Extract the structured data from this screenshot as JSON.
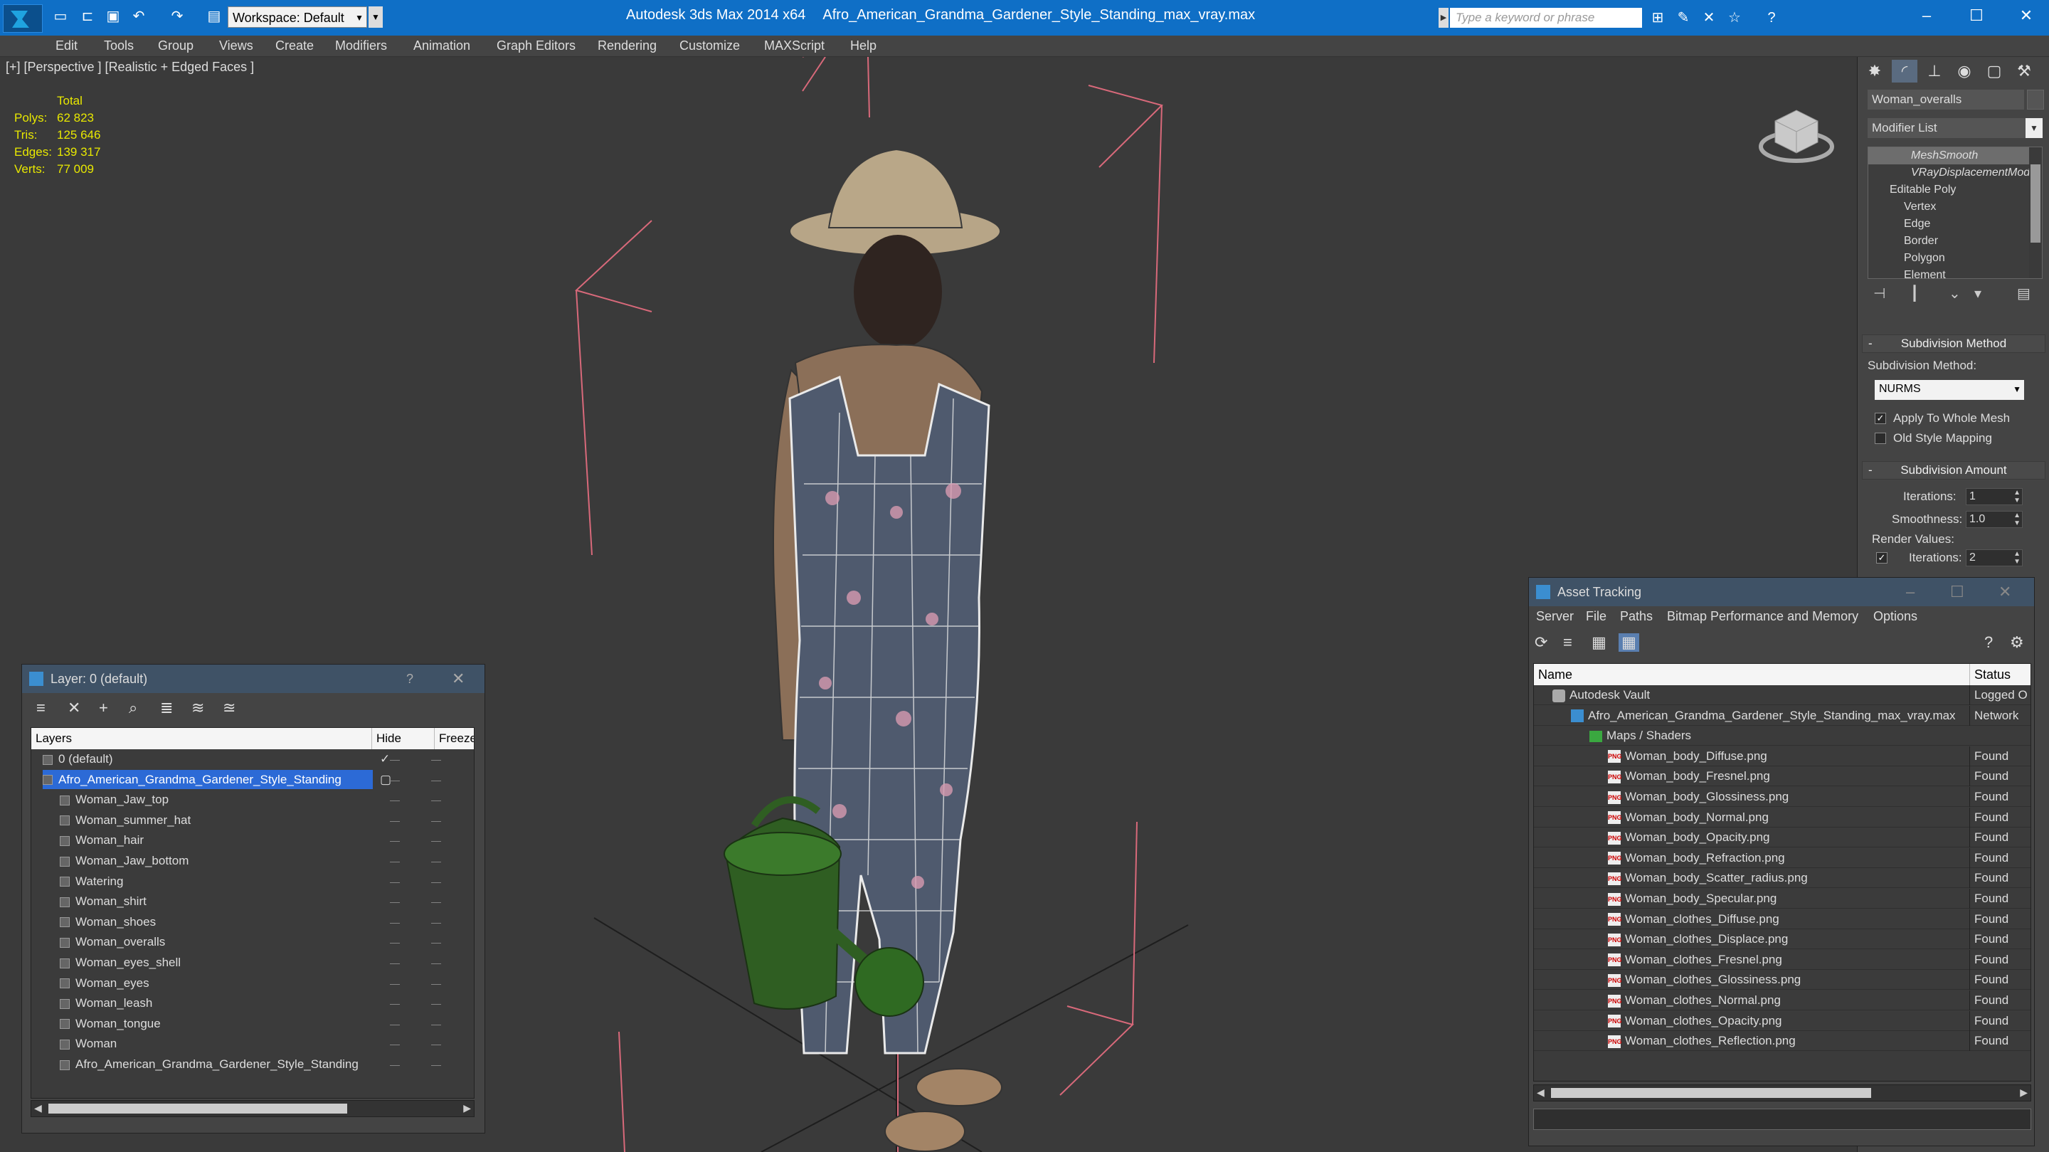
{
  "window": {
    "app_name": "Autodesk 3ds Max  2014 x64",
    "file_name": "Afro_American_Grandma_Gardener_Style_Standing_max_vray.max",
    "workspace": "Workspace: Default",
    "search_placeholder": "Type a keyword or phrase"
  },
  "menu": [
    "Edit",
    "Tools",
    "Group",
    "Views",
    "Create",
    "Modifiers",
    "Animation",
    "Graph Editors",
    "Rendering",
    "Customize",
    "MAXScript",
    "Help"
  ],
  "viewport": {
    "label": "[+] [Perspective ] [Realistic + Edged Faces ]",
    "stats": {
      "header": "Total",
      "rows": [
        {
          "label": "Polys:",
          "value": "62 823"
        },
        {
          "label": "Tris:",
          "value": "125 646"
        },
        {
          "label": "Edges:",
          "value": "139 317"
        },
        {
          "label": "Verts:",
          "value": "77 009"
        }
      ]
    }
  },
  "command_panel": {
    "object_name": "Woman_overalls",
    "modifier_list": "Modifier List",
    "stack": [
      "MeshSmooth",
      "VRayDisplacementMod",
      "Editable Poly",
      "Vertex",
      "Edge",
      "Border",
      "Polygon",
      "Element"
    ],
    "subdivision_method": {
      "title": "Subdivision Method",
      "label": "Subdivision Method:",
      "value": "NURMS",
      "apply_whole_mesh": "Apply To Whole Mesh",
      "old_style_mapping": "Old Style Mapping"
    },
    "subdivision_amount": {
      "title": "Subdivision Amount",
      "iterations_label": "Iterations:",
      "iterations": "1",
      "smoothness_label": "Smoothness:",
      "smoothness": "1.0",
      "render_values": "Render Values:",
      "render_iterations_label": "Iterations:",
      "render_iterations": "2"
    }
  },
  "layer_panel": {
    "title": "Layer: 0 (default)",
    "columns": {
      "layers": "Layers",
      "hide": "Hide",
      "freeze": "Freeze"
    },
    "rows": [
      {
        "name": "0 (default)",
        "level": 0,
        "checked": true,
        "selected": false
      },
      {
        "name": "Afro_American_Grandma_Gardener_Style_Standing",
        "level": 0,
        "checked": false,
        "selected": true
      },
      {
        "name": "Woman_Jaw_top",
        "level": 1
      },
      {
        "name": "Woman_summer_hat",
        "level": 1
      },
      {
        "name": "Woman_hair",
        "level": 1
      },
      {
        "name": "Woman_Jaw_bottom",
        "level": 1
      },
      {
        "name": "Watering",
        "level": 1
      },
      {
        "name": "Woman_shirt",
        "level": 1
      },
      {
        "name": "Woman_shoes",
        "level": 1
      },
      {
        "name": "Woman_overalls",
        "level": 1
      },
      {
        "name": "Woman_eyes_shell",
        "level": 1
      },
      {
        "name": "Woman_eyes",
        "level": 1
      },
      {
        "name": "Woman_leash",
        "level": 1
      },
      {
        "name": "Woman_tongue",
        "level": 1
      },
      {
        "name": "Woman",
        "level": 1
      },
      {
        "name": "Afro_American_Grandma_Gardener_Style_Standing",
        "level": 1
      }
    ]
  },
  "asset_panel": {
    "title": "Asset Tracking",
    "menu": [
      "Server",
      "File",
      "Paths",
      "Bitmap Performance and Memory",
      "Options"
    ],
    "columns": {
      "name": "Name",
      "status": "Status"
    },
    "rows": [
      {
        "name": "Autodesk Vault",
        "status": "Logged O",
        "kind": "vault",
        "level": 1
      },
      {
        "name": "Afro_American_Grandma_Gardener_Style_Standing_max_vray.max",
        "status": "Network",
        "kind": "max",
        "level": 2
      },
      {
        "name": "Maps / Shaders",
        "status": "",
        "kind": "folder",
        "level": 3
      },
      {
        "name": "Woman_body_Diffuse.png",
        "status": "Found",
        "kind": "png",
        "level": 4
      },
      {
        "name": "Woman_body_Fresnel.png",
        "status": "Found",
        "kind": "png",
        "level": 4
      },
      {
        "name": "Woman_body_Glossiness.png",
        "status": "Found",
        "kind": "png",
        "level": 4
      },
      {
        "name": "Woman_body_Normal.png",
        "status": "Found",
        "kind": "png",
        "level": 4
      },
      {
        "name": "Woman_body_Opacity.png",
        "status": "Found",
        "kind": "png",
        "level": 4
      },
      {
        "name": "Woman_body_Refraction.png",
        "status": "Found",
        "kind": "png",
        "level": 4
      },
      {
        "name": "Woman_body_Scatter_radius.png",
        "status": "Found",
        "kind": "png",
        "level": 4
      },
      {
        "name": "Woman_body_Specular.png",
        "status": "Found",
        "kind": "png",
        "level": 4
      },
      {
        "name": "Woman_clothes_Diffuse.png",
        "status": "Found",
        "kind": "png",
        "level": 4
      },
      {
        "name": "Woman_clothes_Displace.png",
        "status": "Found",
        "kind": "png",
        "level": 4
      },
      {
        "name": "Woman_clothes_Fresnel.png",
        "status": "Found",
        "kind": "png",
        "level": 4
      },
      {
        "name": "Woman_clothes_Glossiness.png",
        "status": "Found",
        "kind": "png",
        "level": 4
      },
      {
        "name": "Woman_clothes_Normal.png",
        "status": "Found",
        "kind": "png",
        "level": 4
      },
      {
        "name": "Woman_clothes_Opacity.png",
        "status": "Found",
        "kind": "png",
        "level": 4
      },
      {
        "name": "Woman_clothes_Reflection.png",
        "status": "Found",
        "kind": "png",
        "level": 4
      }
    ]
  }
}
